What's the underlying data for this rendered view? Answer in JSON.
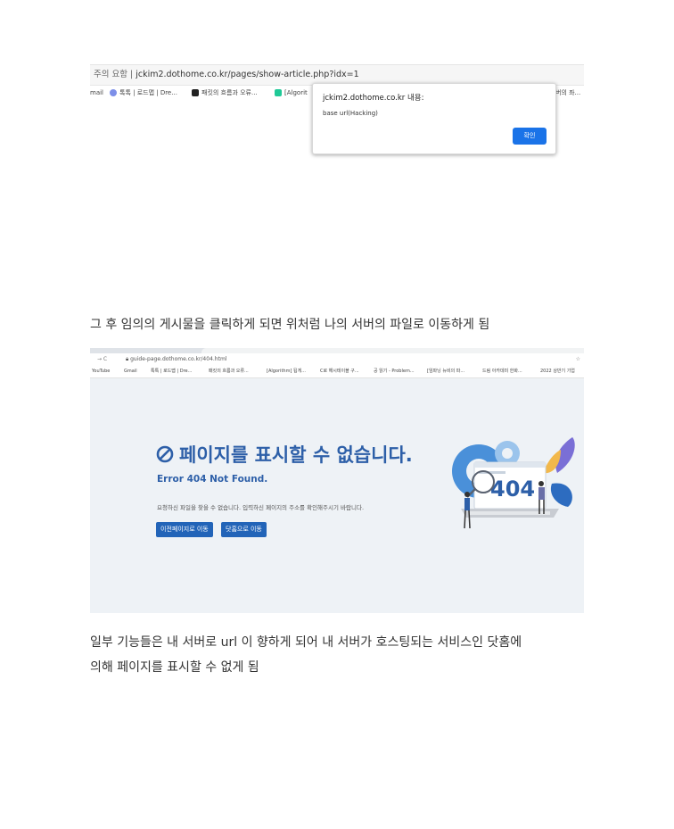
{
  "screenshot1": {
    "urlbar": {
      "warning": "주의 요함 |",
      "url": "jckim2.dothome.co.kr/pages/show-article.php?idx=1"
    },
    "bookmarks": [
      "mail",
      "톡톡 | 로드맵 | Dre...",
      "패킷의 흐름과 오류...",
      "[Algorit",
      "버의 좌..."
    ],
    "alert": {
      "title": "jckim2.dothome.co.kr 내용:",
      "message": "base url(Hacking)",
      "ok_label": "확인"
    }
  },
  "paragraph1": "그 후 임의의 게시물을 클릭하게 되면 위처럼 나의 서버의 파일로 이동하게 됨",
  "screenshot2": {
    "nav": "→  C",
    "url": "guide-page.dothome.co.kr/404.html",
    "right_icons": "☆",
    "bookmarks": [
      "YouTube",
      "Gmail",
      "톡톡 | 로드맵 | Dre...",
      "패킷의 흐름과 오류...",
      "[Algorithm] 됩게...",
      "C로 해시테이블 구...",
      "공 읽기 - Problem...",
      "[임파닝 뉴비의 파...",
      "드림 아카데미 한화...",
      "2022 상반기 기업"
    ],
    "error_title": "페이지를 표시할 수 없습니다.",
    "error_subtitle": "Error 404 Not Found.",
    "error_desc": "요청하신 파일을 찾을 수 없습니다. 입력하신 페이지의 주소를 확인해주시기 바랍니다.",
    "button_prev": "이전페이지로 이동",
    "button_home": "닷홈으로 이동",
    "illustration_text": "404",
    "colors": {
      "accent": "#2d5fa8",
      "button": "#2264b8",
      "gear": "#4a90d9"
    }
  },
  "paragraph2_line1": "일부 기능들은 내 서버로 url 이 향하게 되어 내 서버가 호스팅되는 서비스인 닷홈에",
  "paragraph2_line2": "의해 페이지를 표시할 수 없게 됨"
}
